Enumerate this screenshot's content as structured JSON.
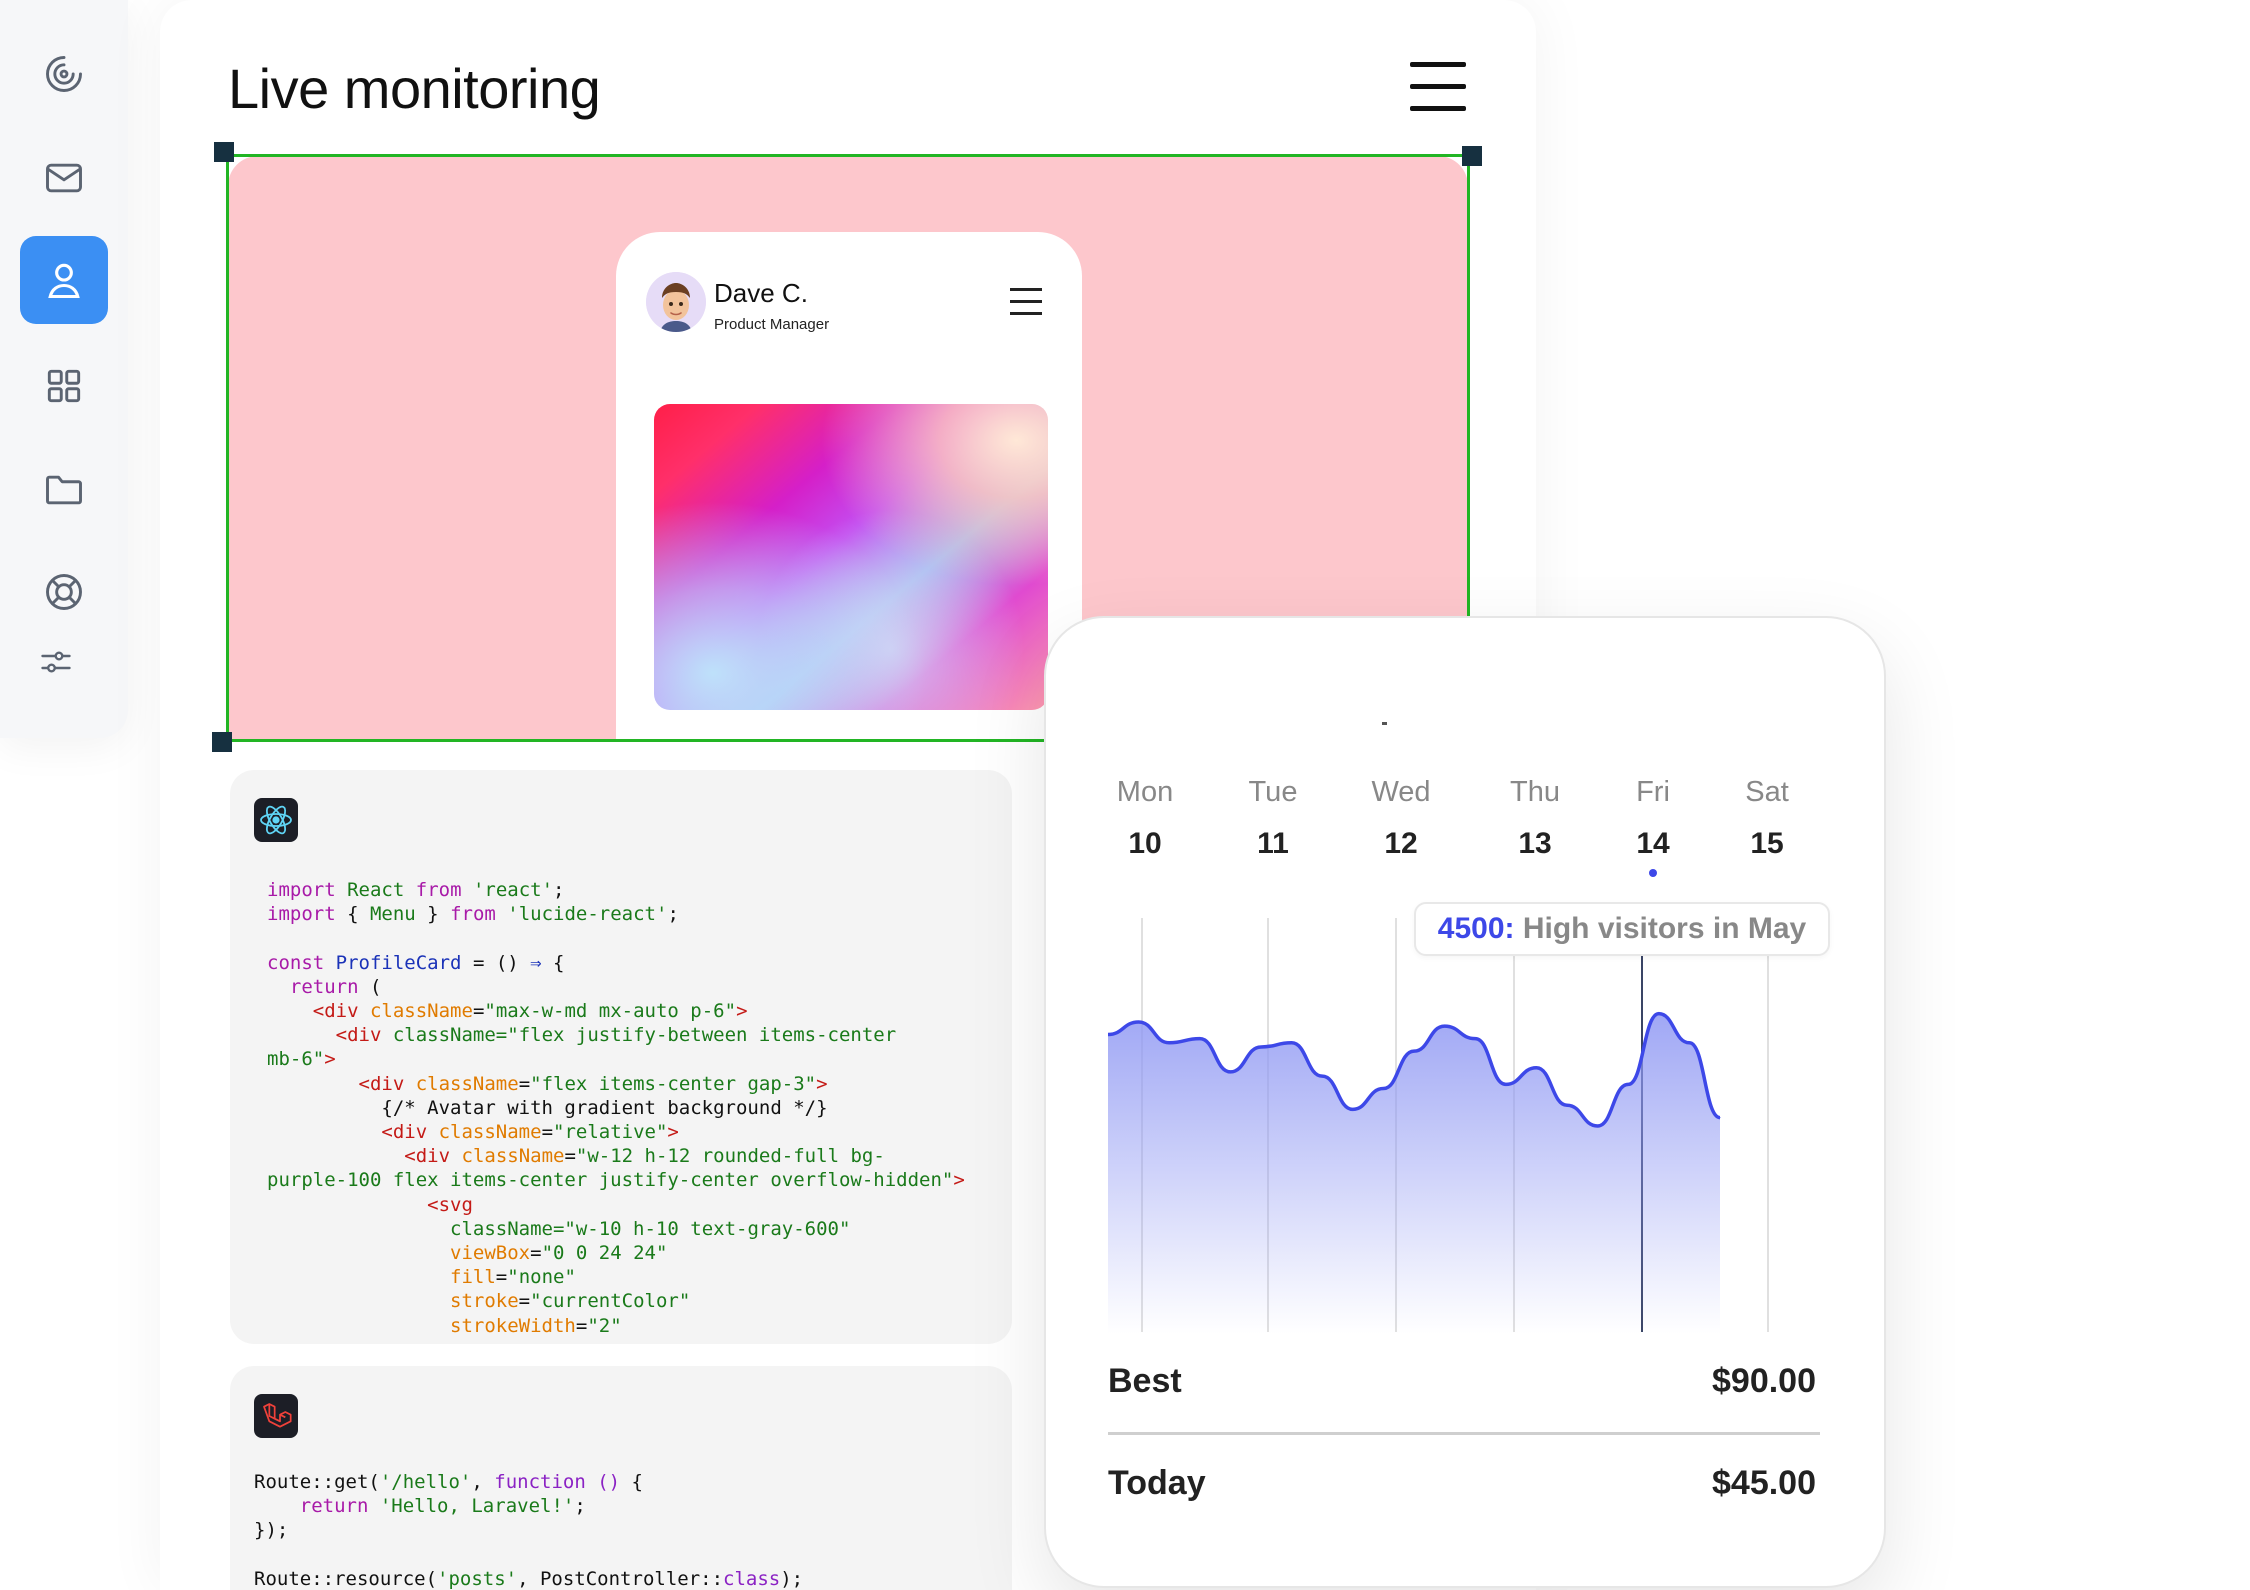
{
  "header": {
    "title": "Live monitoring"
  },
  "sidebar": {
    "items": [
      {
        "icon": "radar-icon",
        "label": ""
      },
      {
        "icon": "mail-icon",
        "label": ""
      },
      {
        "icon": "user-icon",
        "label": "",
        "active": true
      },
      {
        "icon": "grid-icon",
        "label": ""
      },
      {
        "icon": "folder-icon",
        "label": ""
      },
      {
        "icon": "lifebuoy-icon",
        "label": ""
      },
      {
        "icon": "sliders-icon",
        "label": ""
      }
    ]
  },
  "preview": {
    "background": "#fdc7cc",
    "selection_color": "#22b524",
    "profile": {
      "name": "Dave C.",
      "role": "Product Manager"
    }
  },
  "code_blocks": [
    {
      "language_icon": "react-icon",
      "lines": [
        "import React from 'react';",
        "import { Menu } from 'lucide-react';",
        "",
        "const ProfileCard = () ⇒ {",
        "  return (",
        "    <div className=\"max-w-md mx-auto p-6\">",
        "      <div className=\"flex justify-between items-center",
        "mb-6\">",
        "        <div className=\"flex items-center gap-3\">",
        "          {/* Avatar with gradient background */}",
        "          <div className=\"relative\">",
        "            <div className=\"w-12 h-12 rounded-full bg-",
        "purple-100 flex items-center justify-center overflow-hidden\">",
        "              <svg",
        "                className=\"w-10 h-10 text-gray-600\"",
        "                viewBox=\"0 0 24 24\"",
        "                fill=\"none\"",
        "                stroke=\"currentColor\"",
        "                strokeWidth=\"2\""
      ]
    },
    {
      "language_icon": "laravel-icon",
      "lines": [
        "Route::get('/hello', function () {",
        "    return 'Hello, Laravel!';",
        "});",
        "",
        "Route::resource('posts', PostController::class);"
      ]
    }
  ],
  "calendar": {
    "days": [
      {
        "name": "Mon",
        "num": "10"
      },
      {
        "name": "Tue",
        "num": "11"
      },
      {
        "name": "Wed",
        "num": "12"
      },
      {
        "name": "Thu",
        "num": "13"
      },
      {
        "name": "Fri",
        "num": "14",
        "selected": true
      },
      {
        "name": "Sat",
        "num": "15"
      }
    ]
  },
  "tooltip": {
    "value": "4500:",
    "text": " High visitors in May"
  },
  "chart_data": {
    "type": "area",
    "accent": "#3d48e8",
    "fill_top": "#8f98f3",
    "series": [
      {
        "values": [
          72,
          75,
          70,
          71,
          63,
          69,
          70,
          62,
          54,
          59,
          68,
          74,
          71,
          60,
          64,
          55,
          50,
          60,
          77,
          70,
          52
        ]
      }
    ],
    "ylim": [
      0,
      100
    ]
  },
  "summary": {
    "rows": [
      {
        "label": "Best",
        "value": "$90.00"
      },
      {
        "label": "Today",
        "value": "$45.00"
      }
    ]
  }
}
